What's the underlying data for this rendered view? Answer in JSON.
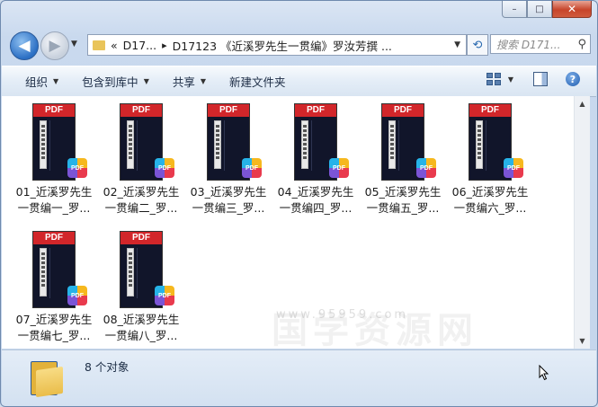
{
  "window": {
    "caption_minimize": "–",
    "caption_maximize": "□",
    "caption_close": "✕"
  },
  "nav": {
    "back_icon": "◀",
    "forward_icon": "▶",
    "history_dropdown": "▼",
    "address": {
      "chevrons": "«",
      "crumb1": "D17...",
      "separator": "▸",
      "crumb2": "D17123 《近溪罗先生一贯编》罗汝芳撰 ...",
      "dropdown": "▼"
    },
    "refresh_icon": "⟲",
    "search_placeholder": "搜索 D171...",
    "search_icon": "⚲"
  },
  "toolbar": {
    "organize": "组织",
    "include_in_library": "包含到库中",
    "share": "共享",
    "new_folder": "新建文件夹",
    "dropdown_arrow": "▼",
    "help_label": "?"
  },
  "files": [
    {
      "line1": "01_近溪罗先生",
      "line2": "一贯编一_罗..."
    },
    {
      "line1": "02_近溪罗先生",
      "line2": "一贯编二_罗..."
    },
    {
      "line1": "03_近溪罗先生",
      "line2": "一贯编三_罗..."
    },
    {
      "line1": "04_近溪罗先生",
      "line2": "一贯编四_罗..."
    },
    {
      "line1": "05_近溪罗先生",
      "line2": "一贯编五_罗..."
    },
    {
      "line1": "06_近溪罗先生",
      "line2": "一贯编六_罗..."
    },
    {
      "line1": "07_近溪罗先生",
      "line2": "一贯编七_罗..."
    },
    {
      "line1": "08_近溪罗先生",
      "line2": "一贯编八_罗..."
    }
  ],
  "thumb_label": "PDF",
  "badge_label": "PDF",
  "scrollbar": {
    "up": "▲",
    "down": "▼"
  },
  "watermark": {
    "big": "国学资源网",
    "small": "www.95959.com"
  },
  "status": {
    "count_text": "8 个对象"
  }
}
